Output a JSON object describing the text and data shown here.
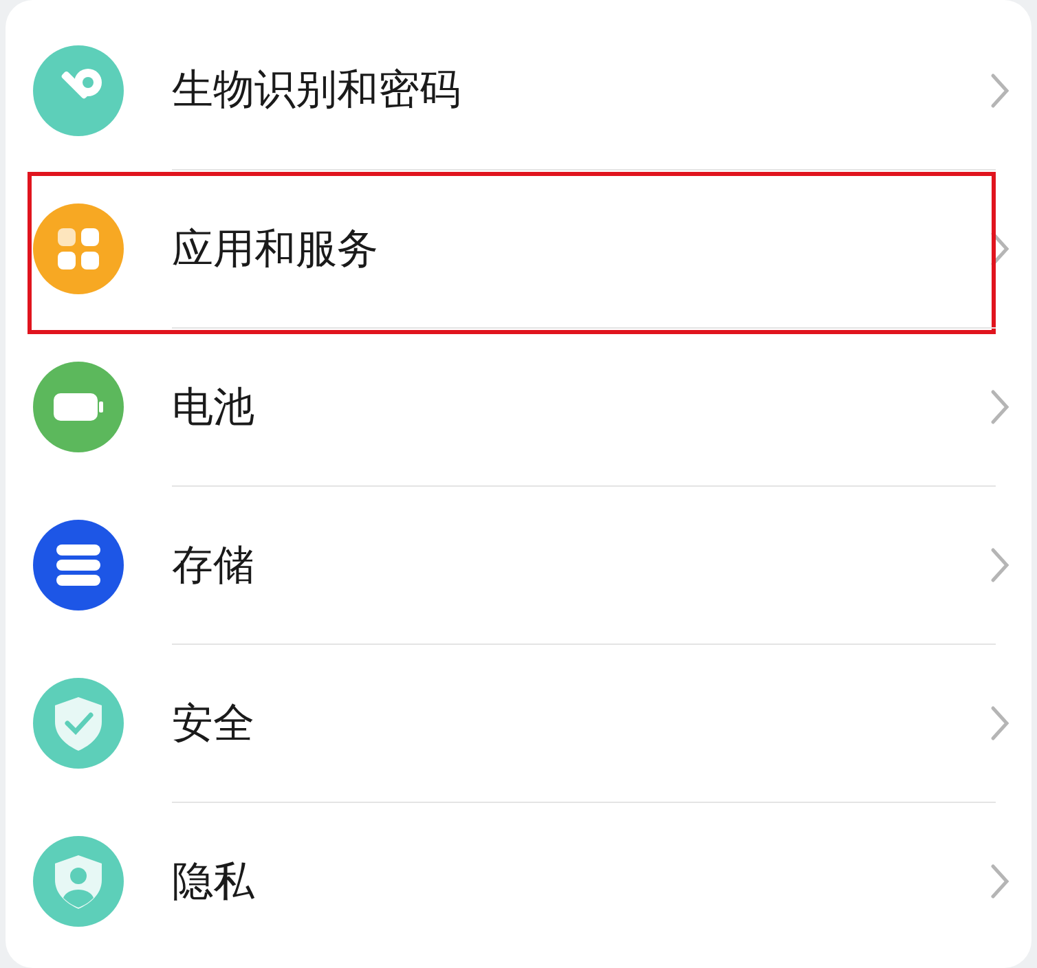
{
  "items": [
    {
      "label": "生物识别和密码",
      "kind": "key",
      "color": "#5dcfb9",
      "highlighted": false
    },
    {
      "label": "应用和服务",
      "kind": "apps",
      "color": "#f7a823",
      "highlighted": true
    },
    {
      "label": "电池",
      "kind": "battery",
      "color": "#5cb85c",
      "highlighted": false
    },
    {
      "label": "存储",
      "kind": "storage",
      "color": "#1d56e6",
      "highlighted": false
    },
    {
      "label": "安全",
      "kind": "security",
      "color": "#5dcfb9",
      "highlighted": false
    },
    {
      "label": "隐私",
      "kind": "privacy",
      "color": "#5dcfb9",
      "highlighted": false
    }
  ]
}
